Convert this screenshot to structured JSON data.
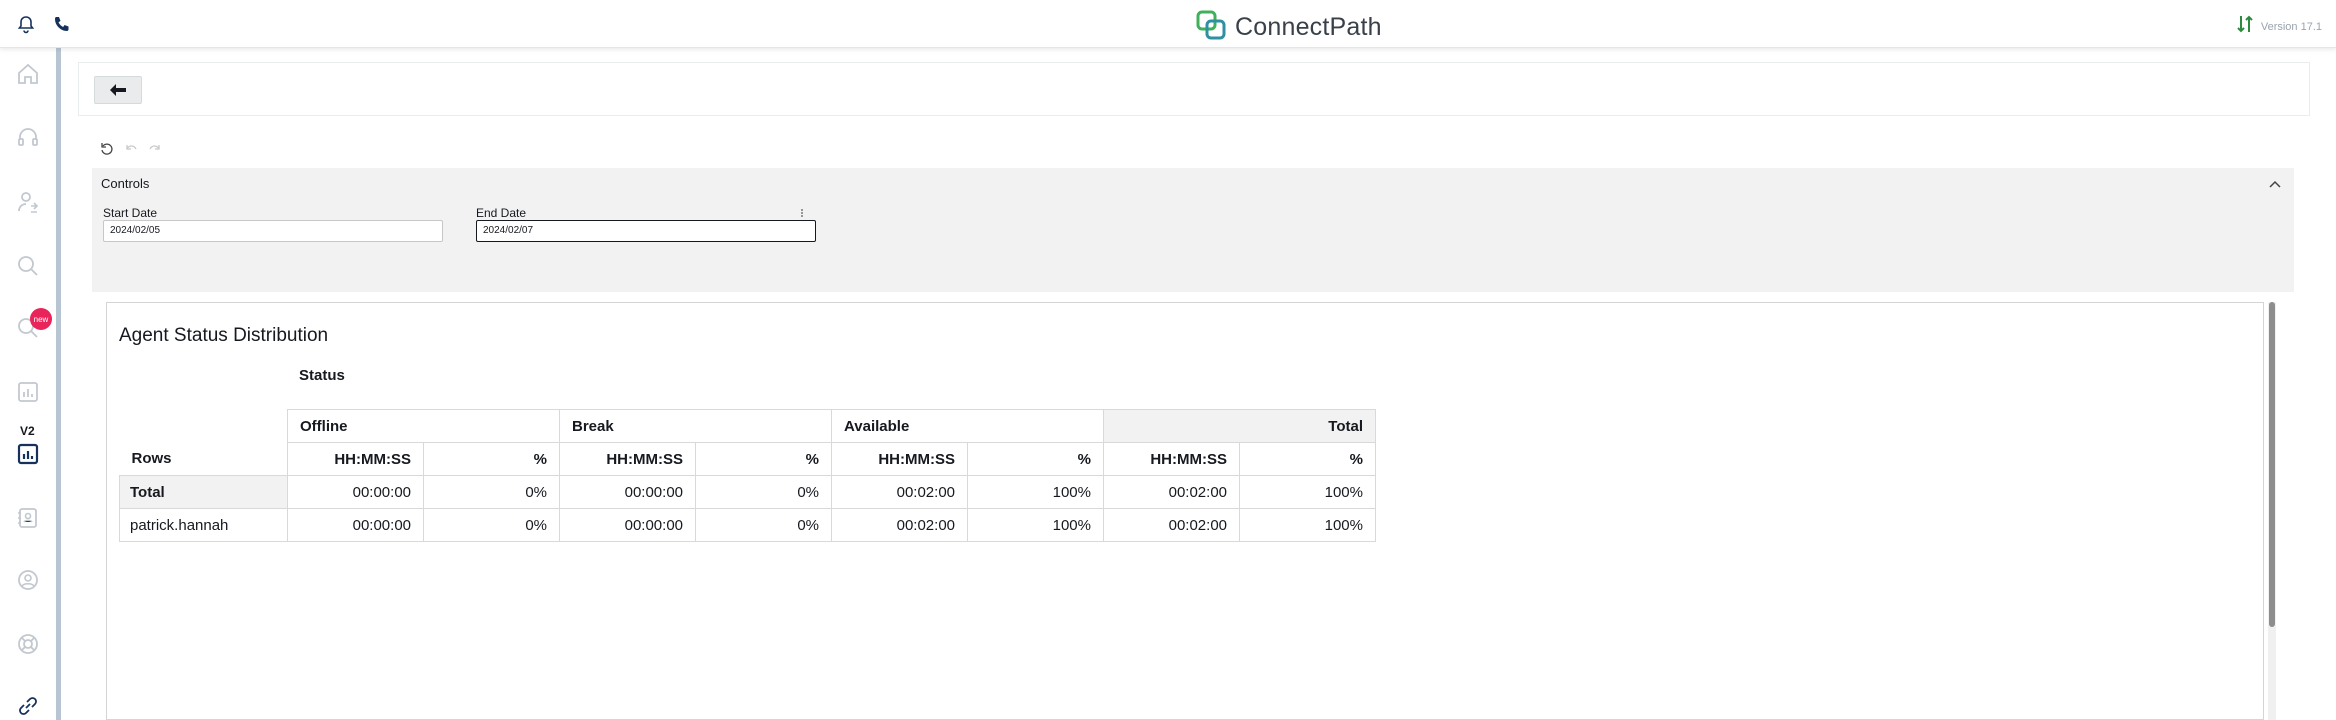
{
  "header": {
    "brand": "ConnectPath",
    "version": "Version 17.1"
  },
  "sidebar": {
    "new_badge": "new",
    "v2_label": "V2"
  },
  "controls": {
    "title": "Controls",
    "start_date": {
      "label": "Start Date",
      "value": "2024/02/05"
    },
    "end_date": {
      "label": "End Date",
      "value": "2024/02/07"
    }
  },
  "visual": {
    "title": "Agent Status Distribution",
    "column_dimension": "Status",
    "rows_header": "Rows",
    "groups": [
      "Offline",
      "Break",
      "Available",
      "Total"
    ],
    "sub_time": "HH:MM:SS",
    "sub_pct": "%",
    "rows": [
      {
        "label": "Total",
        "values": [
          "00:00:00",
          "0%",
          "00:00:00",
          "0%",
          "00:02:00",
          "100%",
          "00:02:00",
          "100%"
        ]
      },
      {
        "label": "patrick.hannah",
        "values": [
          "00:00:00",
          "0%",
          "00:00:00",
          "0%",
          "00:02:00",
          "100%",
          "00:02:00",
          "100%"
        ]
      }
    ]
  },
  "colors": {
    "brand_green": "#3fb05b",
    "brand_teal": "#2f8fa3",
    "badge_red": "#e8245a",
    "nav_blue": "#16325c"
  }
}
